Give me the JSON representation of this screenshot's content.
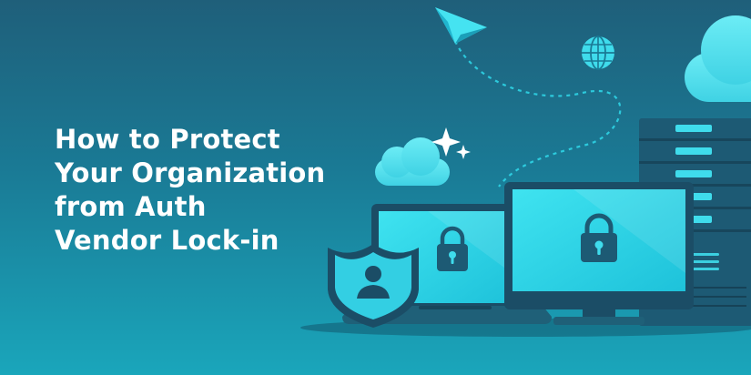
{
  "headline": {
    "lines": [
      "How to Protect",
      "Your Organization",
      "from Auth",
      "Vendor Lock-in"
    ]
  },
  "colors": {
    "bg_top": "#1f5f7a",
    "bg_bottom": "#1aa6bb",
    "screen_cyan": "#27d3e6",
    "frame_dark": "#1b4d66",
    "cloud": "#5ee3ee",
    "text": "#ffffff"
  },
  "icons": [
    "paper-plane-icon",
    "globe-icon",
    "cloud-icon",
    "sparkle-icon",
    "laptop-icon",
    "monitor-icon",
    "server-rack-icon",
    "padlock-icon",
    "shield-user-icon"
  ]
}
